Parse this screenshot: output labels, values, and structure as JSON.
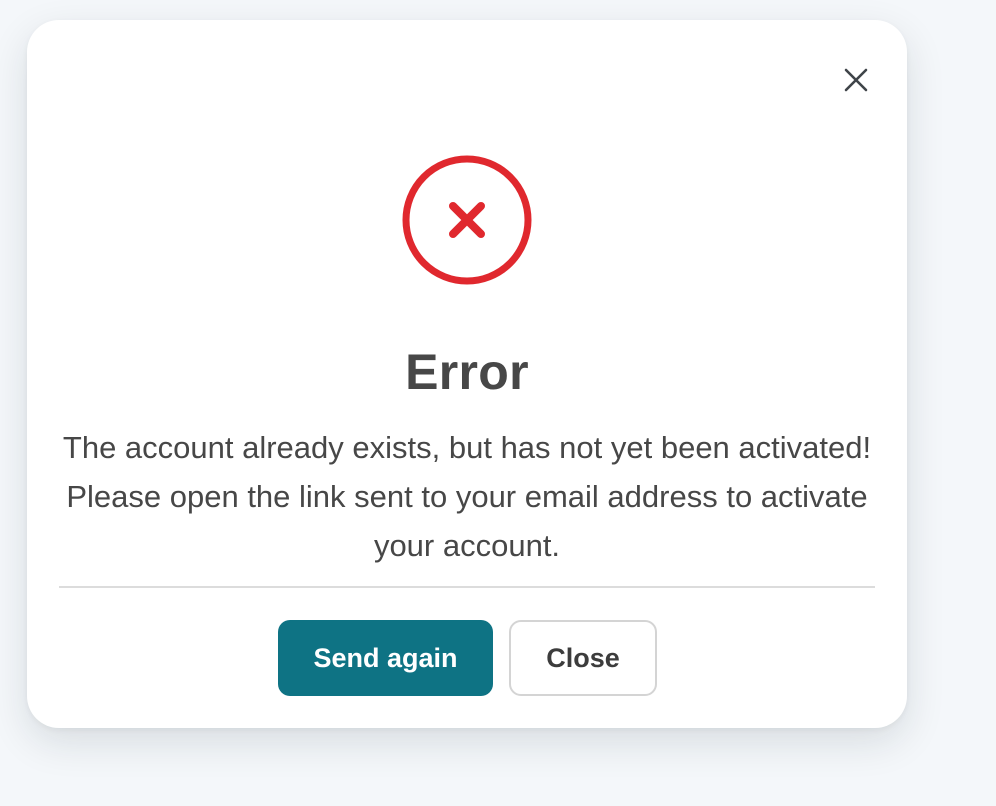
{
  "dialog": {
    "title": "Error",
    "message": "The account already exists, but has not yet been activated! Please open the link sent to your email address to activate your account.",
    "close_icon": "close-icon",
    "status_icon": "error-circle-icon",
    "buttons": {
      "primary_label": "Send again",
      "secondary_label": "Close"
    }
  },
  "colors": {
    "error": "#e0282e",
    "primary_button": "#0e7384",
    "text": "#474747",
    "background": "#f4f7fa"
  }
}
